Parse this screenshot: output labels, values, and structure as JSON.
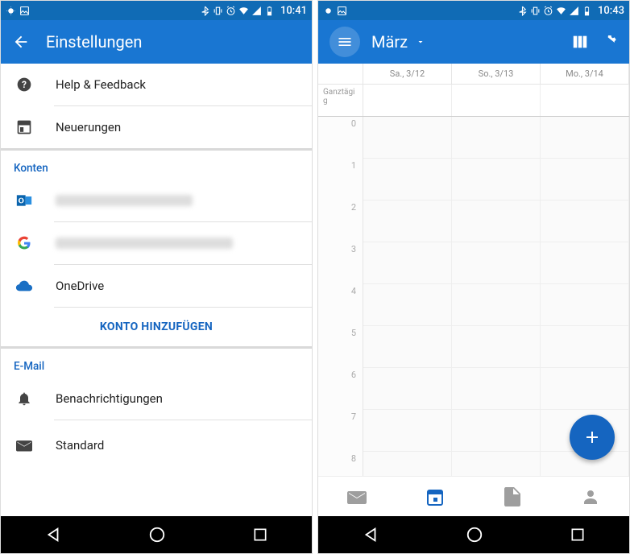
{
  "colors": {
    "primary": "#1976d2",
    "primaryDark": "#106bb5",
    "accent": "#1565c0"
  },
  "left": {
    "status_time": "10:41",
    "title": "Einstellungen",
    "help_label": "Help & Feedback",
    "whatsnew_label": "Neuerungen",
    "section_accounts": "Konten",
    "accounts": [
      {
        "provider": "outlook",
        "label_hidden": true
      },
      {
        "provider": "google",
        "label_hidden": true
      },
      {
        "provider": "onedrive",
        "label": "OneDrive"
      }
    ],
    "add_account": "KONTO HINZUFÜGEN",
    "section_email": "E-Mail",
    "notifications_label": "Benachrichtigungen",
    "standard_label": "Standard"
  },
  "right": {
    "status_time": "10:43",
    "month_label": "März",
    "allday_label": "Ganztägig",
    "days": [
      "Sa., 3/12",
      "So., 3/13",
      "Mo., 3/14"
    ],
    "hours": [
      "0",
      "1",
      "2",
      "3",
      "4",
      "5",
      "6",
      "7",
      "8"
    ],
    "tabs": [
      {
        "name": "mail",
        "active": false
      },
      {
        "name": "calendar",
        "active": true
      },
      {
        "name": "files",
        "active": false
      },
      {
        "name": "people",
        "active": false
      }
    ]
  }
}
